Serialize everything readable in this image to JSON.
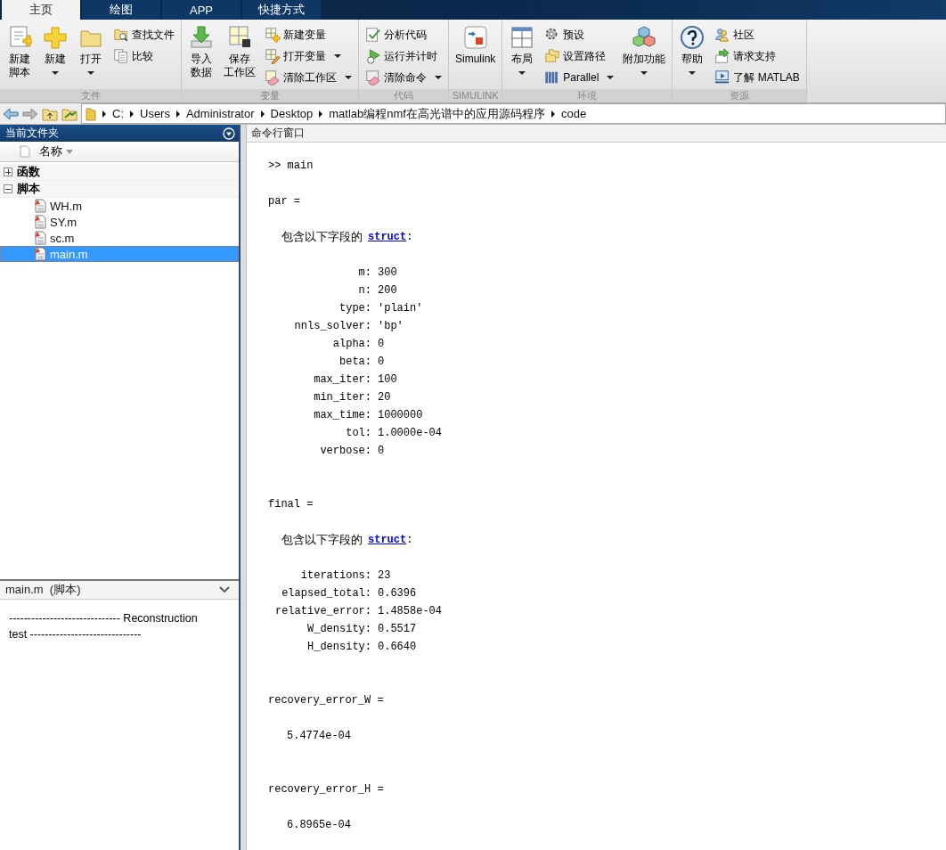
{
  "tabs": [
    {
      "label": "主页",
      "selected": true
    },
    {
      "label": "绘图",
      "selected": false
    },
    {
      "label": "APP",
      "selected": false
    },
    {
      "label": "快捷方式",
      "selected": false
    }
  ],
  "ribbon": [
    {
      "label": "文件",
      "items": [
        {
          "kind": "large",
          "label": [
            "新建",
            "脚本"
          ],
          "dropdown": false
        },
        {
          "kind": "large",
          "label": [
            "新建"
          ],
          "dropdown": true
        },
        {
          "kind": "large",
          "label": [
            "打开"
          ],
          "dropdown": true
        },
        {
          "kind": "stack",
          "items": [
            {
              "label": "查找文件",
              "dropdown": false
            },
            {
              "label": "比较",
              "dropdown": false
            }
          ]
        }
      ]
    },
    {
      "label": "变量",
      "items": [
        {
          "kind": "large",
          "label": [
            "导入",
            "数据"
          ],
          "dropdown": false
        },
        {
          "kind": "large",
          "label": [
            "保存",
            "工作区"
          ],
          "dropdown": false
        },
        {
          "kind": "stack",
          "items": [
            {
              "label": "新建变量",
              "dropdown": false
            },
            {
              "label": "打开变量",
              "dropdown": true
            },
            {
              "label": "清除工作区",
              "dropdown": true
            }
          ]
        }
      ]
    },
    {
      "label": "代码",
      "items": [
        {
          "kind": "stack",
          "items": [
            {
              "label": "分析代码",
              "dropdown": false
            },
            {
              "label": "运行并计时",
              "dropdown": false
            },
            {
              "label": "清除命令",
              "dropdown": true
            }
          ]
        }
      ]
    },
    {
      "label": "SIMULINK",
      "items": [
        {
          "kind": "large",
          "label": [
            "Simulink"
          ],
          "dropdown": false
        }
      ]
    },
    {
      "label": "环境",
      "items": [
        {
          "kind": "large",
          "label": [
            "布局"
          ],
          "dropdown": true
        },
        {
          "kind": "stack",
          "items": [
            {
              "label": "预设",
              "dropdown": false
            },
            {
              "label": "设置路径",
              "dropdown": false
            },
            {
              "label": "Parallel",
              "dropdown": true
            }
          ]
        },
        {
          "kind": "large",
          "label": [
            "附加功能"
          ],
          "dropdown": true
        }
      ]
    },
    {
      "label": "资源",
      "items": [
        {
          "kind": "large",
          "label": [
            "帮助"
          ],
          "dropdown": true
        },
        {
          "kind": "stack",
          "items": [
            {
              "label": "社区",
              "dropdown": false
            },
            {
              "label": "请求支持",
              "dropdown": false
            },
            {
              "label": "了解 MATLAB",
              "dropdown": false
            }
          ]
        }
      ]
    }
  ],
  "address_bar": {
    "path": [
      "C:",
      "Users",
      "Administrator",
      "Desktop",
      "matlab编程nmf在高光谱中的应用源码程序",
      "code"
    ]
  },
  "current_folder": {
    "title": "当前文件夹",
    "column": "名称",
    "tree": [
      {
        "label": "函数",
        "expanded": false
      },
      {
        "label": "脚本",
        "expanded": true,
        "children": [
          {
            "label": "WH.m",
            "selected": false
          },
          {
            "label": "SY.m",
            "selected": false
          },
          {
            "label": "sc.m",
            "selected": false
          },
          {
            "label": "main.m",
            "selected": true
          }
        ]
      }
    ],
    "details": {
      "title": "main.m  (脚本)",
      "text": "------------------------------ Reconstruction test ------------------------------"
    }
  },
  "command_window": {
    "title": "命令行窗口",
    "prompt": ">> main",
    "outputs": [
      {
        "kind": "struct",
        "name": "par =",
        "note": "包含以下字段的",
        "link": "struct",
        "colon": ":",
        "fields": [
          {
            "key": "m:",
            "value": "300"
          },
          {
            "key": "n:",
            "value": "200"
          },
          {
            "key": "type:",
            "value": "'plain'"
          },
          {
            "key": "nnls_solver:",
            "value": "'bp'"
          },
          {
            "key": "alpha:",
            "value": "0"
          },
          {
            "key": "beta:",
            "value": "0"
          },
          {
            "key": "max_iter:",
            "value": "100"
          },
          {
            "key": "min_iter:",
            "value": "20"
          },
          {
            "key": "max_time:",
            "value": "1000000"
          },
          {
            "key": "tol:",
            "value": "1.0000e-04"
          },
          {
            "key": "verbose:",
            "value": "0"
          }
        ]
      },
      {
        "kind": "struct",
        "name": "final =",
        "note": "包含以下字段的",
        "link": "struct",
        "colon": ":",
        "fields": [
          {
            "key": "iterations:",
            "value": "23"
          },
          {
            "key": "elapsed_total:",
            "value": "0.6396"
          },
          {
            "key": "relative_error:",
            "value": "1.4858e-04"
          },
          {
            "key": "W_density:",
            "value": "0.5517"
          },
          {
            "key": "H_density:",
            "value": "0.6640"
          }
        ]
      },
      {
        "kind": "scalar",
        "name": "recovery_error_W =",
        "value": "5.4774e-04"
      },
      {
        "kind": "scalar",
        "name": "recovery_error_H =",
        "value": "6.8965e-04"
      }
    ]
  }
}
